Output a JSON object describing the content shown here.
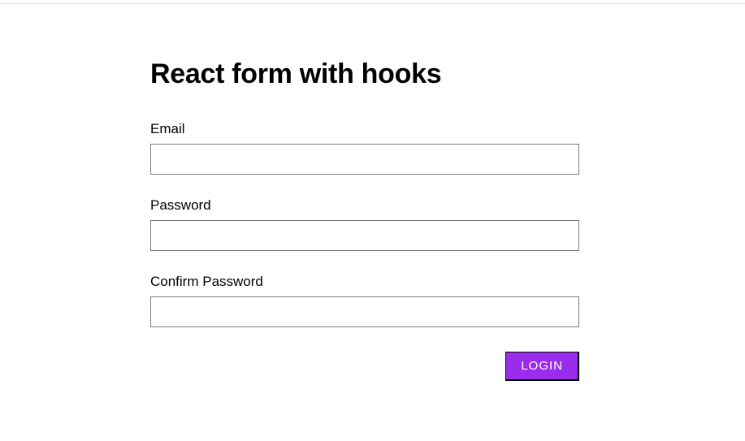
{
  "page": {
    "title": "React form with hooks"
  },
  "form": {
    "email": {
      "label": "Email",
      "value": ""
    },
    "password": {
      "label": "Password",
      "value": ""
    },
    "confirmPassword": {
      "label": "Confirm Password",
      "value": ""
    },
    "submit": {
      "label": "LOGIN"
    }
  },
  "colors": {
    "accent": "#9a2deb"
  }
}
